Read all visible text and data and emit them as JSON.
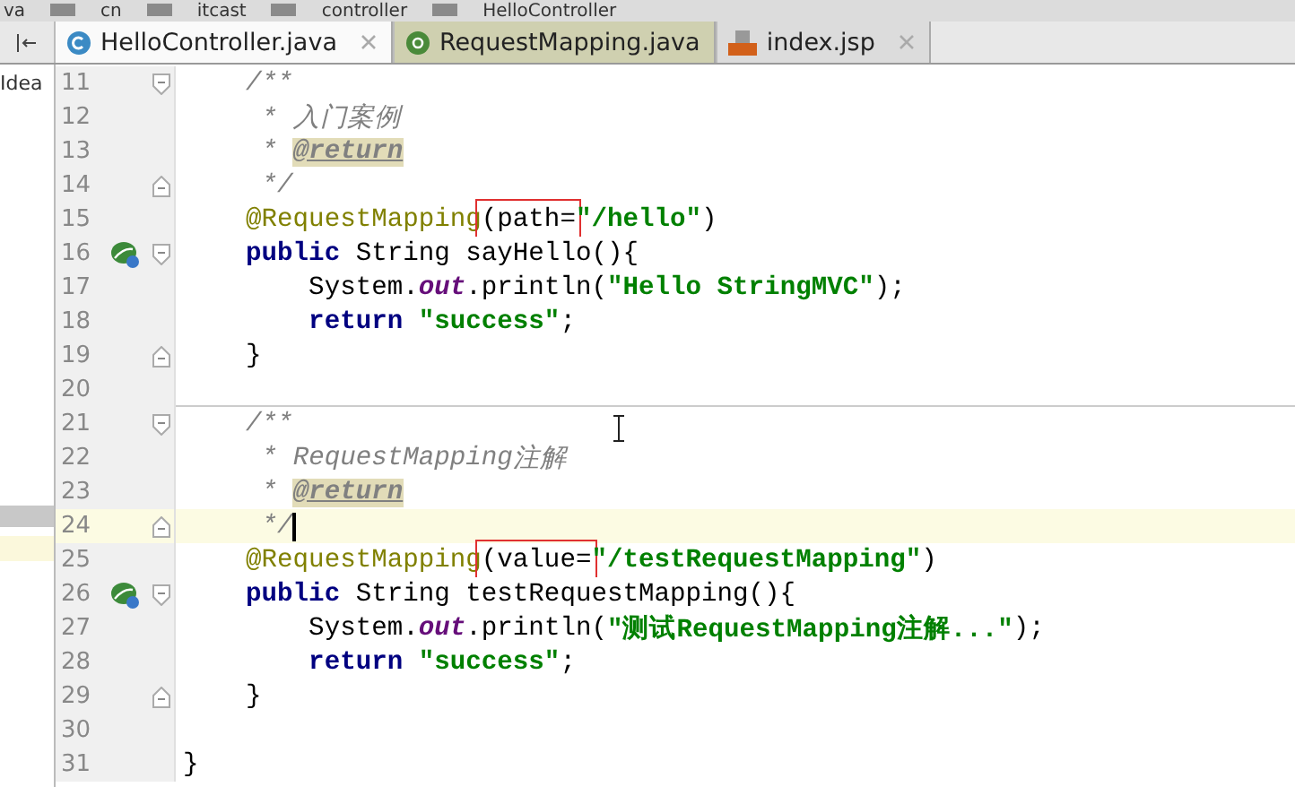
{
  "breadcrumbs": [
    "va",
    "cn",
    "itcast",
    "controller",
    "HelloController"
  ],
  "project_panel": {
    "label": "Idea",
    "rows": [
      {
        "selected": true,
        "kind": "gray"
      },
      {
        "selected": false,
        "kind": "yellow"
      }
    ]
  },
  "tabs": [
    {
      "label": "HelloController.java",
      "kind": "class",
      "selected": true,
      "closable": true
    },
    {
      "label": "RequestMapping.java",
      "kind": "annotation",
      "selected": false,
      "closable": false
    },
    {
      "label": "index.jsp",
      "kind": "jsp",
      "selected": false,
      "closable": true
    }
  ],
  "lines": [
    {
      "number": "11",
      "fold_open": true,
      "tokens": [
        {
          "kind": "comment",
          "text": "    /**"
        }
      ]
    },
    {
      "number": "12",
      "tokens": [
        {
          "kind": "comment",
          "text": "     * 入门案例"
        }
      ]
    },
    {
      "number": "13",
      "tokens": [
        {
          "kind": "comment",
          "text": "     * "
        },
        {
          "kind": "doc_tag",
          "text": "@return"
        }
      ]
    },
    {
      "number": "14",
      "fold_close": true,
      "tokens": [
        {
          "kind": "comment",
          "text": "     */"
        }
      ]
    },
    {
      "number": "15",
      "tokens": [
        {
          "kind": "annotation",
          "text": "    @RequestMapping"
        },
        {
          "kind": "plain",
          "text": "(path=",
          "boxed": true
        },
        {
          "kind": "string",
          "text": "\"/hello\""
        },
        {
          "kind": "plain",
          "text": ")"
        }
      ]
    },
    {
      "number": "16",
      "fold_open": true,
      "run_icon": true,
      "tokens": [
        {
          "kind": "keyword",
          "text": "    public "
        },
        {
          "kind": "plain",
          "text": "String sayHello(){"
        }
      ]
    },
    {
      "number": "17",
      "tokens": [
        {
          "kind": "plain",
          "text": "        System."
        },
        {
          "kind": "field",
          "text": "out"
        },
        {
          "kind": "plain",
          "text": ".println("
        },
        {
          "kind": "string",
          "text": "\"Hello StringMVC\""
        },
        {
          "kind": "plain",
          "text": ");"
        }
      ]
    },
    {
      "number": "18",
      "tokens": [
        {
          "kind": "keyword",
          "text": "        return "
        },
        {
          "kind": "string",
          "text": "\"success\""
        },
        {
          "kind": "plain",
          "text": ";"
        }
      ]
    },
    {
      "number": "19",
      "fold_close": true,
      "tokens": [
        {
          "kind": "plain",
          "text": "    }"
        }
      ]
    },
    {
      "number": "20",
      "separator": true
    },
    {
      "number": "21",
      "fold_open": true,
      "tokens": [
        {
          "kind": "comment",
          "text": "    /**"
        }
      ]
    },
    {
      "number": "22",
      "tokens": [
        {
          "kind": "comment",
          "text": "     * "
        },
        {
          "kind": "doc_italic",
          "text": "RequestMapping"
        },
        {
          "kind": "comment",
          "text": "注解"
        }
      ]
    },
    {
      "number": "23",
      "tokens": [
        {
          "kind": "comment",
          "text": "     * "
        },
        {
          "kind": "doc_tag",
          "text": "@return"
        }
      ]
    },
    {
      "number": "24",
      "fold_close": true,
      "current": true,
      "tokens": [
        {
          "kind": "comment",
          "text": "     */"
        }
      ]
    },
    {
      "number": "25",
      "tokens": [
        {
          "kind": "annotation",
          "text": "    @RequestMapping"
        },
        {
          "kind": "plain",
          "text": "(value=",
          "boxed": true
        },
        {
          "kind": "string",
          "text": "\"/testRequestMapping\""
        },
        {
          "kind": "plain",
          "text": ")"
        }
      ]
    },
    {
      "number": "26",
      "fold_open": true,
      "run_icon": true,
      "tokens": [
        {
          "kind": "keyword",
          "text": "    public "
        },
        {
          "kind": "plain",
          "text": "String testRequestMapping(){"
        }
      ]
    },
    {
      "number": "27",
      "tokens": [
        {
          "kind": "plain",
          "text": "        System."
        },
        {
          "kind": "field",
          "text": "out"
        },
        {
          "kind": "plain",
          "text": ".println("
        },
        {
          "kind": "string",
          "text": "\"测试RequestMapping注解...\""
        },
        {
          "kind": "plain",
          "text": ");"
        }
      ]
    },
    {
      "number": "28",
      "tokens": [
        {
          "kind": "keyword",
          "text": "        return "
        },
        {
          "kind": "string",
          "text": "\"success\""
        },
        {
          "kind": "plain",
          "text": ";"
        }
      ]
    },
    {
      "number": "29",
      "fold_close": true,
      "tokens": [
        {
          "kind": "plain",
          "text": "    }"
        }
      ]
    },
    {
      "number": "30"
    },
    {
      "number": "31",
      "tokens": [
        {
          "kind": "plain",
          "text": "}"
        }
      ]
    }
  ]
}
